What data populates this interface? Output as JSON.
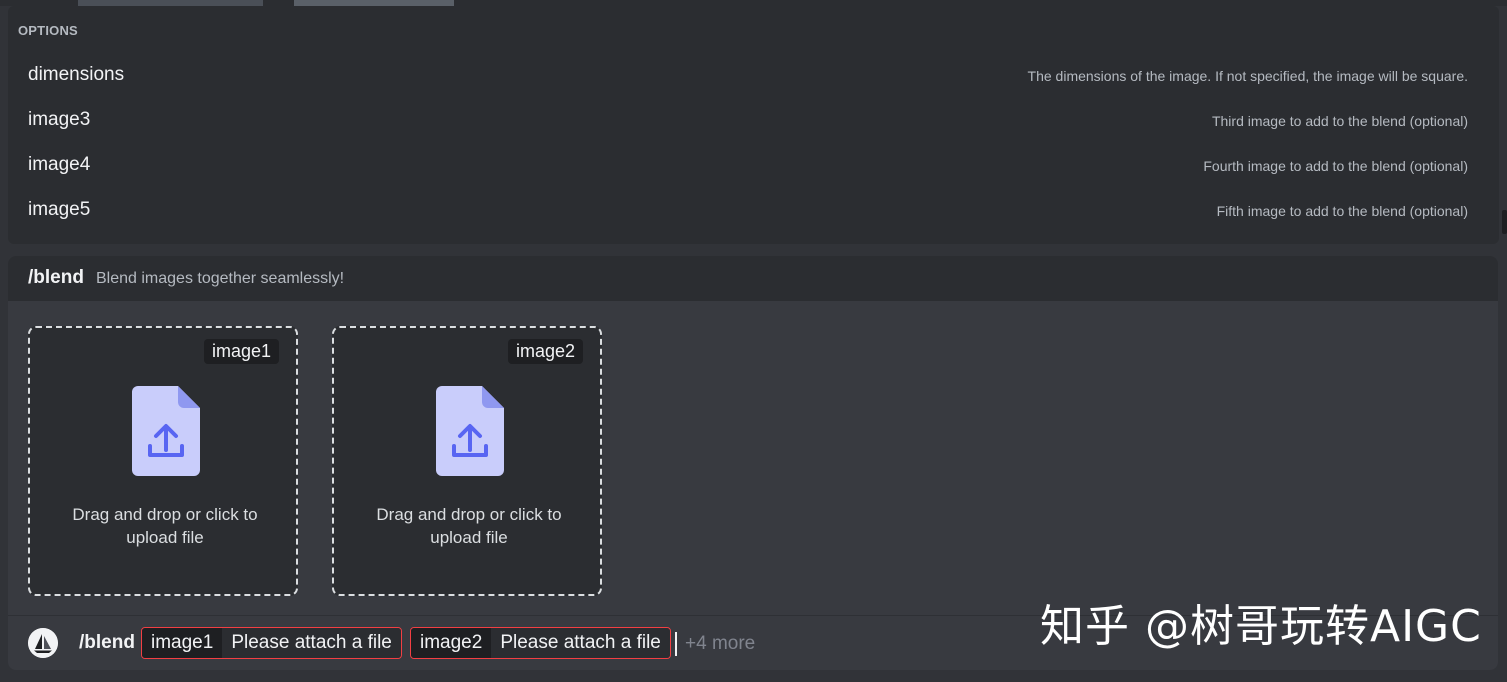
{
  "options": {
    "header": "OPTIONS",
    "items": [
      {
        "name": "dimensions",
        "description": "The dimensions of the image. If not specified, the image will be square."
      },
      {
        "name": "image3",
        "description": "Third image to add to the blend (optional)"
      },
      {
        "name": "image4",
        "description": "Fourth image to add to the blend (optional)"
      },
      {
        "name": "image5",
        "description": "Fifth image to add to the blend (optional)"
      }
    ]
  },
  "command": {
    "name": "/blend",
    "description": "Blend images together seamlessly!"
  },
  "uploads": [
    {
      "label": "image1",
      "text_line1": "Drag and drop or click to",
      "text_line2": "upload file",
      "icon": "upload-file-icon"
    },
    {
      "label": "image2",
      "text_line1": "Drag and drop or click to",
      "text_line2": "upload file",
      "icon": "upload-file-icon"
    }
  ],
  "input": {
    "command": "/blend",
    "params": [
      {
        "key": "image1",
        "value": "Please attach a file"
      },
      {
        "key": "image2",
        "value": "Please attach a file"
      }
    ],
    "more": "+4 more"
  },
  "watermark": "知乎 @树哥玩转AIGC",
  "colors": {
    "background": "#313338",
    "panel": "#2b2d31",
    "error_border": "#f23f43",
    "icon_fill": "#c9cdfb",
    "icon_accent": "#5865f2"
  }
}
